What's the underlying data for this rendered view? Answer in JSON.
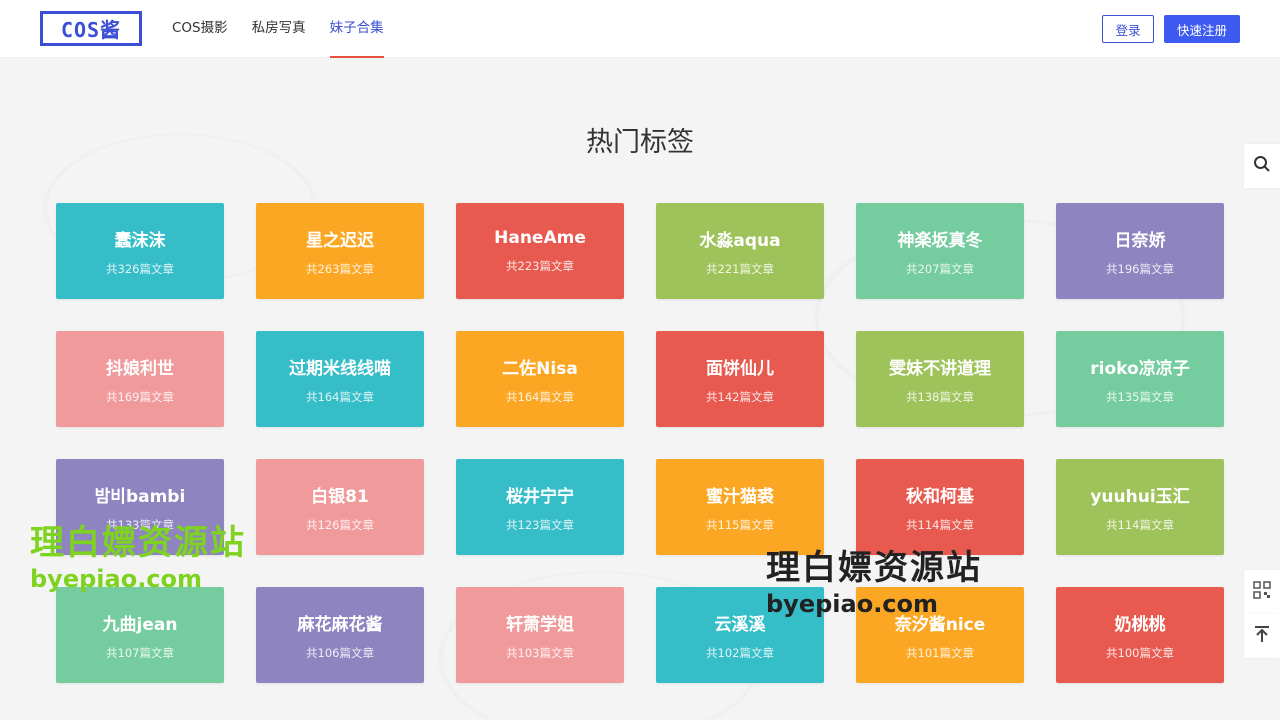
{
  "header": {
    "logo_text": "COS酱",
    "nav": [
      {
        "label": "COS摄影",
        "active": false
      },
      {
        "label": "私房写真",
        "active": false
      },
      {
        "label": "妹子合集",
        "active": true
      }
    ],
    "login_label": "登录",
    "register_label": "快速注册"
  },
  "main": {
    "title": "热门标签",
    "tags": [
      {
        "name": "蠢沫沫",
        "count": "共326篇文章",
        "color": "#35bdc8"
      },
      {
        "name": "星之迟迟",
        "count": "共263篇文章",
        "color": "#fca723"
      },
      {
        "name": "HaneAme",
        "count": "共223篇文章",
        "color": "#e85a50"
      },
      {
        "name": "水淼aqua",
        "count": "共221篇文章",
        "color": "#9fc35b"
      },
      {
        "name": "神楽坂真冬",
        "count": "共207篇文章",
        "color": "#75cc9e"
      },
      {
        "name": "日奈娇",
        "count": "共196篇文章",
        "color": "#8e84c0"
      },
      {
        "name": "抖娘利世",
        "count": "共169篇文章",
        "color": "#f19a9b"
      },
      {
        "name": "过期米线线喵",
        "count": "共164篇文章",
        "color": "#35bdc8"
      },
      {
        "name": "二佐Nisa",
        "count": "共164篇文章",
        "color": "#fca723"
      },
      {
        "name": "面饼仙儿",
        "count": "共142篇文章",
        "color": "#e85a50"
      },
      {
        "name": "雯妹不讲道理",
        "count": "共138篇文章",
        "color": "#9fc35b"
      },
      {
        "name": "rioko凉凉子",
        "count": "共135篇文章",
        "color": "#75cc9e"
      },
      {
        "name": "밤비bambi",
        "count": "共133篇文章",
        "color": "#8e84c0"
      },
      {
        "name": "白银81",
        "count": "共126篇文章",
        "color": "#f19a9b"
      },
      {
        "name": "桜井宁宁",
        "count": "共123篇文章",
        "color": "#35bdc8"
      },
      {
        "name": "蜜汁猫裘",
        "count": "共115篇文章",
        "color": "#fca723"
      },
      {
        "name": "秋和柯基",
        "count": "共114篇文章",
        "color": "#e85a50"
      },
      {
        "name": "yuuhui玉汇",
        "count": "共114篇文章",
        "color": "#9fc35b"
      },
      {
        "name": "九曲jean",
        "count": "共107篇文章",
        "color": "#75cc9e"
      },
      {
        "name": "麻花麻花酱",
        "count": "共106篇文章",
        "color": "#8e84c0"
      },
      {
        "name": "轩萧学姐",
        "count": "共103篇文章",
        "color": "#f19a9b"
      },
      {
        "name": "云溪溪",
        "count": "共102篇文章",
        "color": "#35bdc8"
      },
      {
        "name": "奈汐酱nice",
        "count": "共101篇文章",
        "color": "#fca723"
      },
      {
        "name": "奶桃桃",
        "count": "共100篇文章",
        "color": "#e85a50"
      }
    ]
  },
  "sidebar_tools": {
    "search_icon": "search-icon",
    "qrcode_icon": "qrcode-icon",
    "back_to_top_icon": "back-to-top-icon"
  },
  "watermarks": [
    {
      "title": "理白嫖资源站",
      "url": "byepiao.com",
      "color": "#7ed321"
    },
    {
      "title": "理白嫖资源站",
      "url": "byepiao.com",
      "color": "#222222"
    }
  ]
}
